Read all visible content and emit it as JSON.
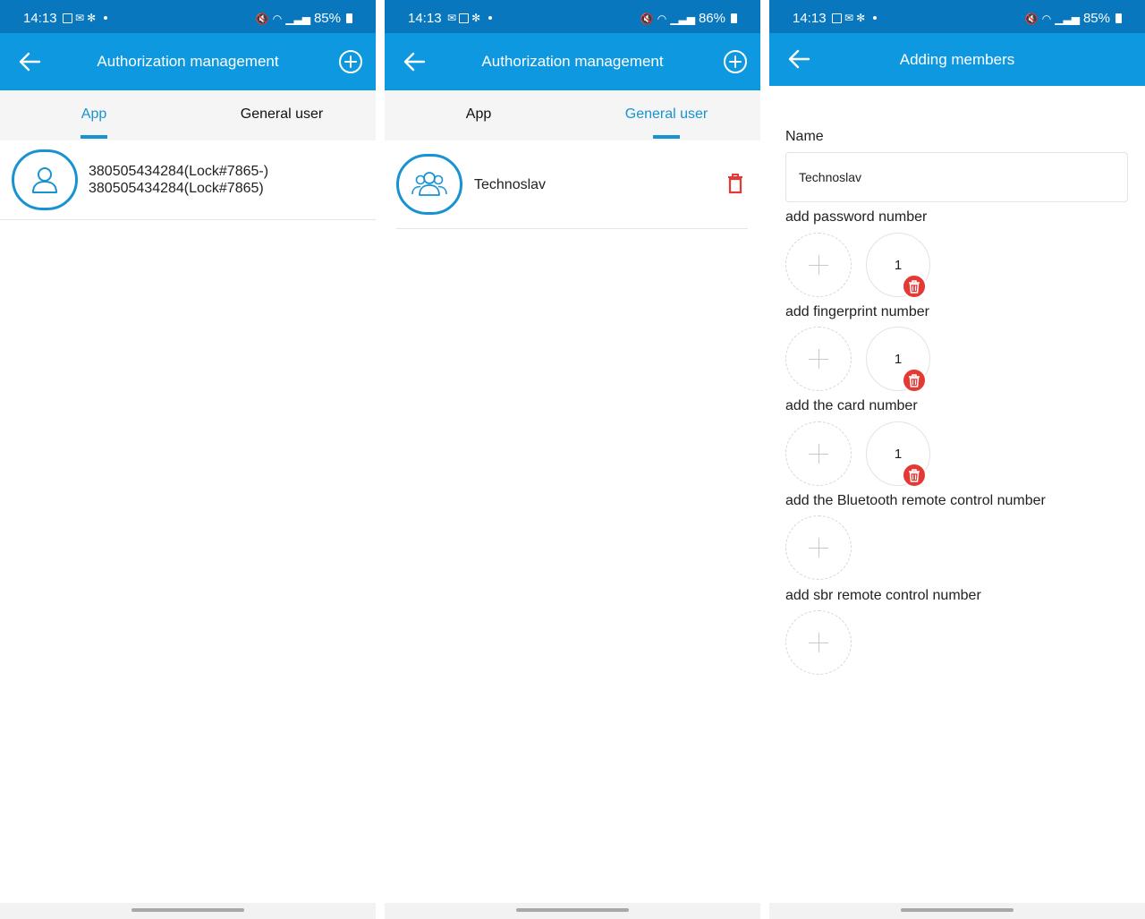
{
  "screens": [
    {
      "status": {
        "time": "14:13",
        "battery": "85%"
      },
      "appbar": {
        "title": "Authorization management"
      },
      "tabs": [
        {
          "label": "App",
          "active": true
        },
        {
          "label": "General user",
          "active": false
        }
      ],
      "row": {
        "line1": "380505434284(Lock#7865-)",
        "line2": "380505434284(Lock#7865)"
      }
    },
    {
      "status": {
        "time": "14:13",
        "battery": "86%"
      },
      "appbar": {
        "title": "Authorization management"
      },
      "tabs": [
        {
          "label": "App",
          "active": false
        },
        {
          "label": "General user",
          "active": true
        }
      ],
      "row": {
        "name": "Technoslav"
      }
    },
    {
      "status": {
        "time": "14:13",
        "battery": "85%"
      },
      "appbar": {
        "title": "Adding members"
      },
      "form": {
        "name_label": "Name",
        "name_value": "Technoslav",
        "password_label": "add password number",
        "password_value": "1",
        "fingerprint_label": "add fingerprint number",
        "fingerprint_value": "1",
        "card_label": "add the card number",
        "card_value": "1",
        "bluetooth_label": "add the Bluetooth remote control number",
        "sbr_label": "add sbr remote control number"
      }
    }
  ],
  "colors": {
    "status_bar": "#0877bd",
    "app_bar": "#0d98e0",
    "accent": "#1793d1",
    "delete": "#e53935"
  },
  "icons": [
    "back-arrow-icon",
    "add-circle-icon",
    "user-icon",
    "group-icon",
    "trash-icon",
    "plus-icon"
  ]
}
